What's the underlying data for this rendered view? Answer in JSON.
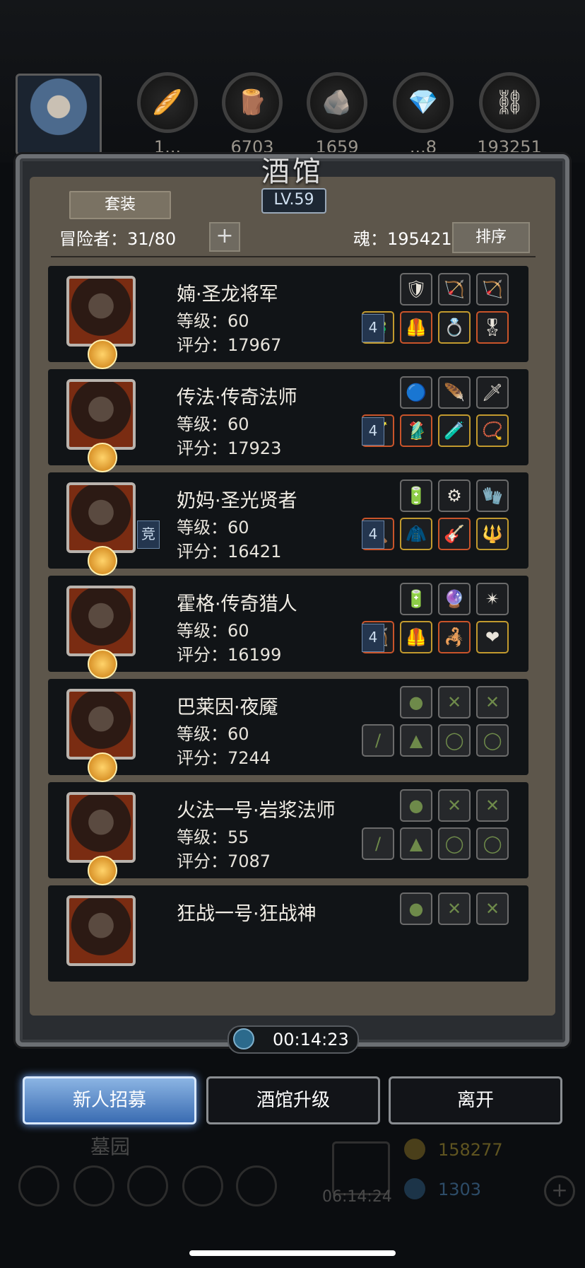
{
  "resources": [
    {
      "icon": "food-icon",
      "glyph": "🥖",
      "value": "1..."
    },
    {
      "icon": "wood-icon",
      "glyph": "🪵",
      "value": "6703"
    },
    {
      "icon": "stone-icon",
      "glyph": "🪨",
      "value": "1659"
    },
    {
      "icon": "crystal-icon",
      "glyph": "💎",
      "value": "...8"
    },
    {
      "icon": "iron-icon",
      "glyph": "⛓",
      "value": "193251"
    }
  ],
  "tavern": {
    "title": "酒馆",
    "level": "LV.59",
    "set_button": "套装",
    "adventurers": "冒险者：31/80",
    "plus": "+",
    "soul": "魂：195421",
    "sort_button": "排序"
  },
  "heroes": [
    {
      "name": "婻·圣龙将军",
      "level": "等级：60",
      "score": "评分：17967",
      "tag": "4",
      "side_tag": ""
    },
    {
      "name": "传法·传奇法师",
      "level": "等级：60",
      "score": "评分：17923",
      "tag": "4",
      "side_tag": ""
    },
    {
      "name": "奶妈·圣光贤者",
      "level": "等级：60",
      "score": "评分：16421",
      "tag": "4",
      "side_tag": "竞"
    },
    {
      "name": "霍格·传奇猎人",
      "level": "等级：60",
      "score": "评分：16199",
      "tag": "4",
      "side_tag": ""
    },
    {
      "name": "巴莱因·夜魇",
      "level": "等级：60",
      "score": "评分：7244",
      "tag": "",
      "side_tag": ""
    },
    {
      "name": "火法一号·岩浆法师",
      "level": "等级：55",
      "score": "评分：7087",
      "tag": "",
      "side_tag": ""
    },
    {
      "name": "狂战一号·狂战神",
      "level": "",
      "score": "",
      "tag": "",
      "side_tag": ""
    }
  ],
  "timer": "00:14:23",
  "buttons": {
    "recruit": "新人招募",
    "upgrade": "酒馆升级",
    "leave": "离开"
  },
  "background": {
    "graveyard": "墓园",
    "gift_timer": "06:14:24",
    "gold": "158277",
    "gems": "1303"
  }
}
